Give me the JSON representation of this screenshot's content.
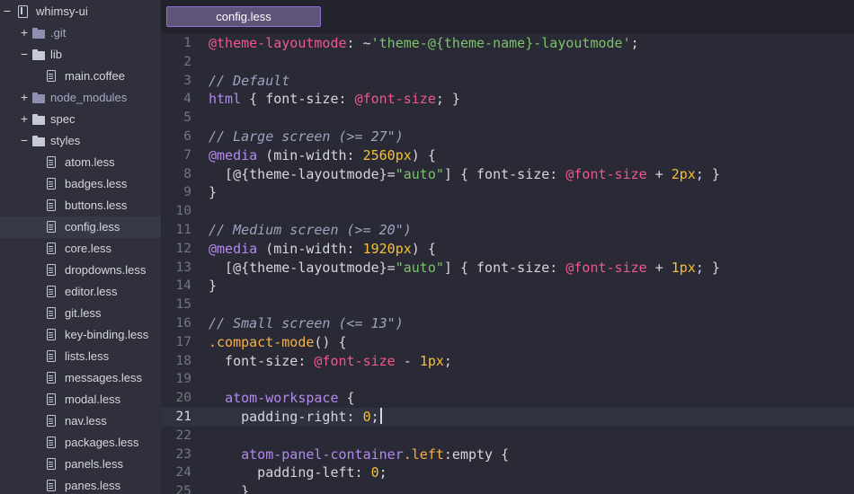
{
  "tab": {
    "title": "config.less"
  },
  "tree": [
    {
      "label": "whimsy-ui",
      "kind": "repo",
      "toggle": "−",
      "depth": 0
    },
    {
      "label": ".git",
      "kind": "folder",
      "toggle": "+",
      "depth": 1,
      "dim": true
    },
    {
      "label": "lib",
      "kind": "folder",
      "toggle": "−",
      "depth": 1
    },
    {
      "label": "main.coffee",
      "kind": "file",
      "toggle": "",
      "depth": 2
    },
    {
      "label": "node_modules",
      "kind": "folder",
      "toggle": "+",
      "depth": 1,
      "dim": true
    },
    {
      "label": "spec",
      "kind": "folder",
      "toggle": "+",
      "depth": 1
    },
    {
      "label": "styles",
      "kind": "folder",
      "toggle": "−",
      "depth": 1
    },
    {
      "label": "atom.less",
      "kind": "file",
      "toggle": "",
      "depth": 2
    },
    {
      "label": "badges.less",
      "kind": "file",
      "toggle": "",
      "depth": 2
    },
    {
      "label": "buttons.less",
      "kind": "file",
      "toggle": "",
      "depth": 2
    },
    {
      "label": "config.less",
      "kind": "file",
      "toggle": "",
      "depth": 2,
      "selected": true
    },
    {
      "label": "core.less",
      "kind": "file",
      "toggle": "",
      "depth": 2
    },
    {
      "label": "dropdowns.less",
      "kind": "file",
      "toggle": "",
      "depth": 2
    },
    {
      "label": "editor.less",
      "kind": "file",
      "toggle": "",
      "depth": 2
    },
    {
      "label": "git.less",
      "kind": "file",
      "toggle": "",
      "depth": 2
    },
    {
      "label": "key-binding.less",
      "kind": "file",
      "toggle": "",
      "depth": 2
    },
    {
      "label": "lists.less",
      "kind": "file",
      "toggle": "",
      "depth": 2
    },
    {
      "label": "messages.less",
      "kind": "file",
      "toggle": "",
      "depth": 2
    },
    {
      "label": "modal.less",
      "kind": "file",
      "toggle": "",
      "depth": 2
    },
    {
      "label": "nav.less",
      "kind": "file",
      "toggle": "",
      "depth": 2
    },
    {
      "label": "packages.less",
      "kind": "file",
      "toggle": "",
      "depth": 2
    },
    {
      "label": "panels.less",
      "kind": "file",
      "toggle": "",
      "depth": 2
    },
    {
      "label": "panes.less",
      "kind": "file",
      "toggle": "",
      "depth": 2
    }
  ],
  "editor": {
    "cursor_line": 21,
    "lines": [
      {
        "n": "1",
        "tokens": [
          [
            "var",
            "@theme-layoutmode"
          ],
          [
            "txt",
            ": ~"
          ],
          [
            "str",
            "'theme-@{theme-name}-layoutmode'"
          ],
          [
            "txt",
            ";"
          ]
        ]
      },
      {
        "n": "2",
        "tokens": []
      },
      {
        "n": "3",
        "tokens": [
          [
            "cmt",
            "// Default"
          ]
        ]
      },
      {
        "n": "4",
        "tokens": [
          [
            "tag",
            "html"
          ],
          [
            "txt",
            " { font-size: "
          ],
          [
            "var",
            "@font-size"
          ],
          [
            "txt",
            "; }"
          ]
        ]
      },
      {
        "n": "5",
        "tokens": []
      },
      {
        "n": "6",
        "tokens": [
          [
            "cmt",
            "// Large screen (>= 27\")"
          ]
        ]
      },
      {
        "n": "7",
        "tokens": [
          [
            "at",
            "@media"
          ],
          [
            "txt",
            " (min-width: "
          ],
          [
            "num",
            "2560px"
          ],
          [
            "txt",
            ") {"
          ]
        ]
      },
      {
        "n": "8",
        "tokens": [
          [
            "txt",
            "  [@{theme-layoutmode}="
          ],
          [
            "str",
            "\"auto\""
          ],
          [
            "txt",
            "] { font-size: "
          ],
          [
            "var",
            "@font-size"
          ],
          [
            "txt",
            " + "
          ],
          [
            "num",
            "2px"
          ],
          [
            "txt",
            "; }"
          ]
        ]
      },
      {
        "n": "9",
        "tokens": [
          [
            "txt",
            "}"
          ]
        ]
      },
      {
        "n": "10",
        "tokens": []
      },
      {
        "n": "11",
        "tokens": [
          [
            "cmt",
            "// Medium screen (>= 20\")"
          ]
        ]
      },
      {
        "n": "12",
        "tokens": [
          [
            "at",
            "@media"
          ],
          [
            "txt",
            " (min-width: "
          ],
          [
            "num",
            "1920px"
          ],
          [
            "txt",
            ") {"
          ]
        ]
      },
      {
        "n": "13",
        "tokens": [
          [
            "txt",
            "  [@{theme-layoutmode}="
          ],
          [
            "str",
            "\"auto\""
          ],
          [
            "txt",
            "] { font-size: "
          ],
          [
            "var",
            "@font-size"
          ],
          [
            "txt",
            " + "
          ],
          [
            "num",
            "1px"
          ],
          [
            "txt",
            "; }"
          ]
        ]
      },
      {
        "n": "14",
        "tokens": [
          [
            "txt",
            "}"
          ]
        ]
      },
      {
        "n": "15",
        "tokens": []
      },
      {
        "n": "16",
        "tokens": [
          [
            "cmt",
            "// Small screen (<= 13\")"
          ]
        ]
      },
      {
        "n": "17",
        "tokens": [
          [
            "cls",
            ".compact-mode"
          ],
          [
            "txt",
            "() {"
          ]
        ]
      },
      {
        "n": "18",
        "tokens": [
          [
            "txt",
            "  font-size: "
          ],
          [
            "var",
            "@font-size"
          ],
          [
            "txt",
            " - "
          ],
          [
            "num",
            "1px"
          ],
          [
            "txt",
            ";"
          ]
        ]
      },
      {
        "n": "19",
        "tokens": []
      },
      {
        "n": "20",
        "tokens": [
          [
            "txt",
            "  "
          ],
          [
            "tag",
            "atom-workspace"
          ],
          [
            "txt",
            " {"
          ]
        ]
      },
      {
        "n": "21",
        "tokens": [
          [
            "txt",
            "    padding-right: "
          ],
          [
            "num",
            "0"
          ],
          [
            "txt",
            ";"
          ]
        ]
      },
      {
        "n": "22",
        "tokens": []
      },
      {
        "n": "23",
        "tokens": [
          [
            "txt",
            "    "
          ],
          [
            "tag",
            "atom-panel-container"
          ],
          [
            "cls",
            ".left"
          ],
          [
            "txt",
            ":empty {"
          ]
        ]
      },
      {
        "n": "24",
        "tokens": [
          [
            "txt",
            "      padding-left: "
          ],
          [
            "num",
            "0"
          ],
          [
            "txt",
            ";"
          ]
        ]
      },
      {
        "n": "25",
        "tokens": [
          [
            "txt",
            "    }"
          ]
        ]
      }
    ]
  },
  "colors": {
    "background": "#292a35",
    "tree_background": "#2f303c",
    "accent": "#8e6fd1",
    "variable": "#f0578a",
    "string": "#7ec16c",
    "number": "#f5bf3a",
    "keyword": "#b389ed",
    "comment": "#a0a2c0"
  }
}
